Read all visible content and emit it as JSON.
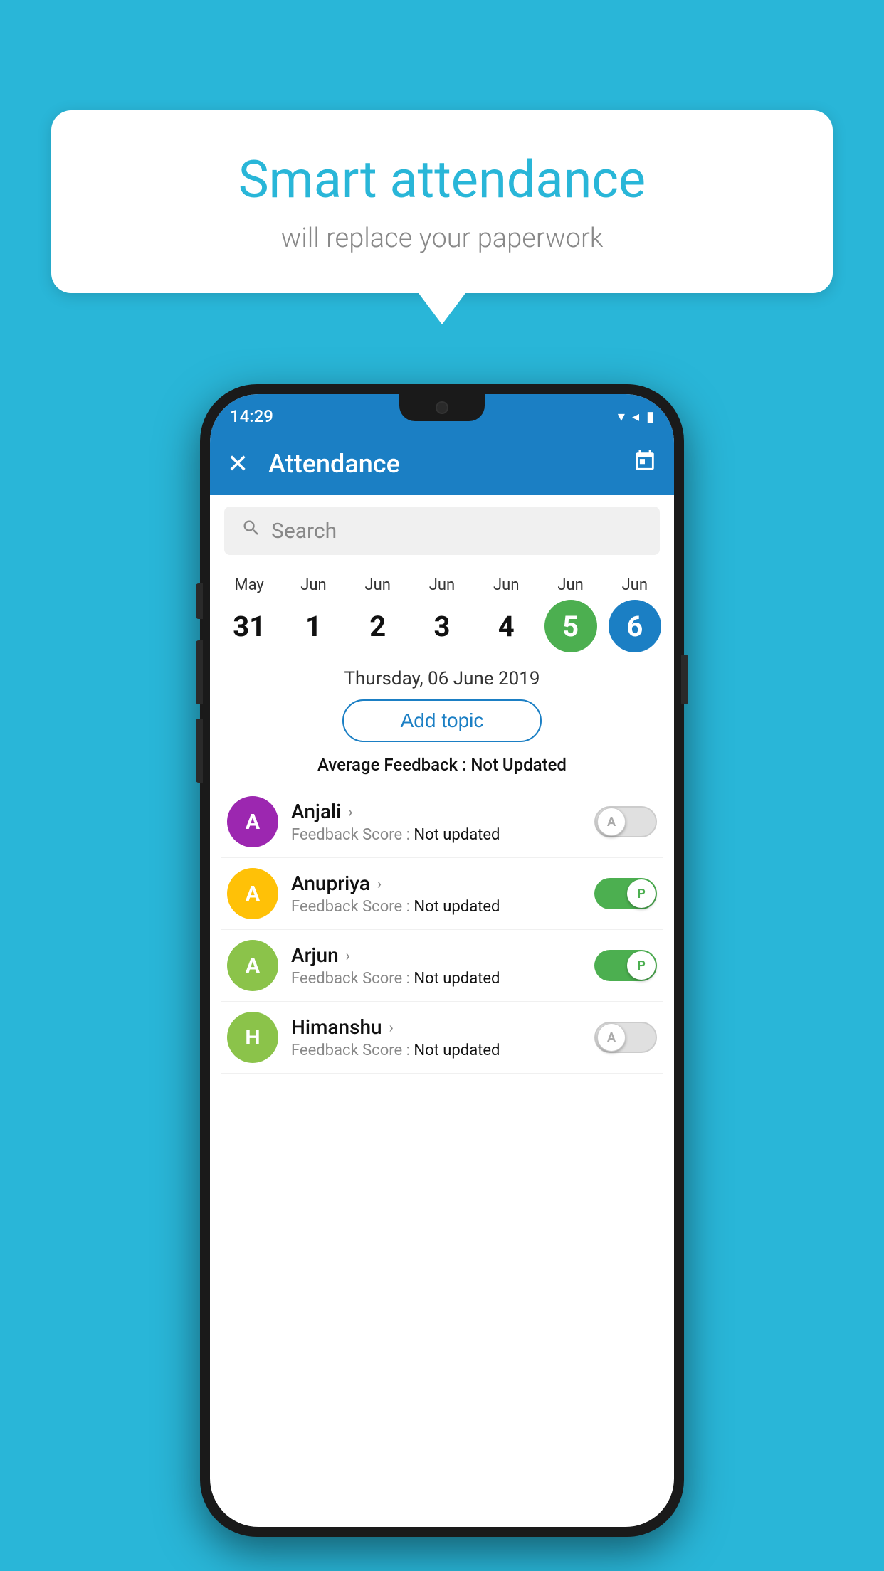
{
  "background_color": "#29b6d8",
  "speech_bubble": {
    "title": "Smart attendance",
    "subtitle": "will replace your paperwork"
  },
  "status_bar": {
    "time": "14:29",
    "signal_icons": "▼◀▮"
  },
  "app_bar": {
    "title": "Attendance",
    "close_icon": "✕",
    "calendar_icon": "📅"
  },
  "search": {
    "placeholder": "Search"
  },
  "calendar": {
    "columns": [
      {
        "month": "May",
        "day": "31",
        "state": "normal"
      },
      {
        "month": "Jun",
        "day": "1",
        "state": "normal"
      },
      {
        "month": "Jun",
        "day": "2",
        "state": "normal"
      },
      {
        "month": "Jun",
        "day": "3",
        "state": "normal"
      },
      {
        "month": "Jun",
        "day": "4",
        "state": "normal"
      },
      {
        "month": "Jun",
        "day": "5",
        "state": "today"
      },
      {
        "month": "Jun",
        "day": "6",
        "state": "selected"
      }
    ],
    "selected_date_label": "Thursday, 06 June 2019"
  },
  "add_topic_button": "Add topic",
  "avg_feedback": {
    "label": "Average Feedback : ",
    "value": "Not Updated"
  },
  "students": [
    {
      "name": "Anjali",
      "avatar_letter": "A",
      "avatar_color": "#9c27b0",
      "feedback_label": "Feedback Score : ",
      "feedback_value": "Not updated",
      "toggle_state": "off",
      "toggle_label": "A"
    },
    {
      "name": "Anupriya",
      "avatar_letter": "A",
      "avatar_color": "#ffc107",
      "feedback_label": "Feedback Score : ",
      "feedback_value": "Not updated",
      "toggle_state": "on",
      "toggle_label": "P"
    },
    {
      "name": "Arjun",
      "avatar_letter": "A",
      "avatar_color": "#8bc34a",
      "feedback_label": "Feedback Score : ",
      "feedback_value": "Not updated",
      "toggle_state": "on",
      "toggle_label": "P"
    },
    {
      "name": "Himanshu",
      "avatar_letter": "H",
      "avatar_color": "#8bc34a",
      "feedback_label": "Feedback Score : ",
      "feedback_value": "Not updated",
      "toggle_state": "off",
      "toggle_label": "A"
    }
  ]
}
